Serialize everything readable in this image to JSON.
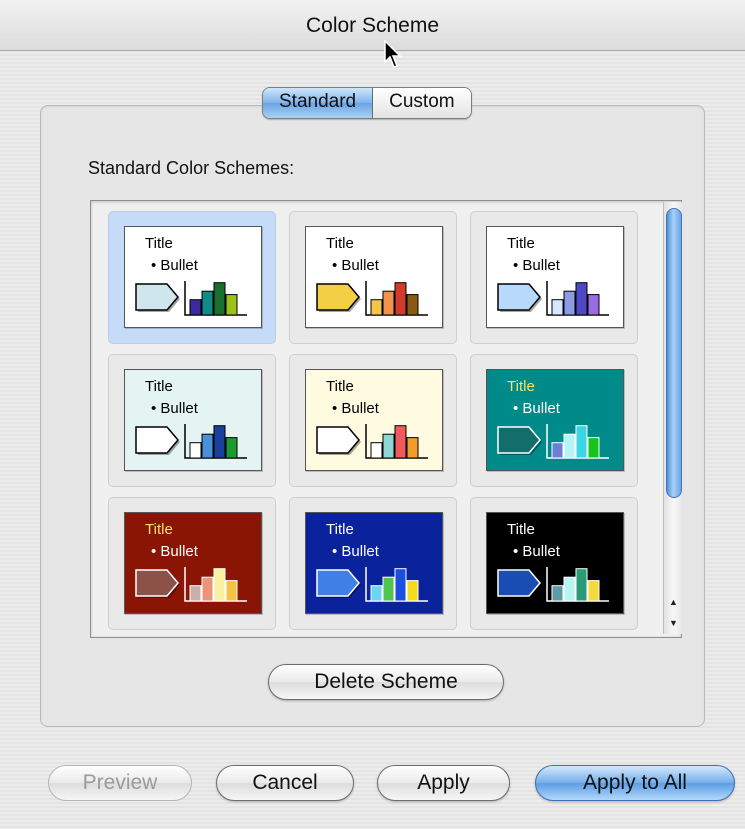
{
  "window": {
    "title": "Color Scheme"
  },
  "tabs": [
    {
      "label": "Standard",
      "active": true
    },
    {
      "label": "Custom",
      "active": false
    }
  ],
  "schemes_label": "Standard Color Schemes:",
  "schemes": [
    {
      "title": "Title",
      "bullet": "• Bullet",
      "bg": "#ffffff",
      "text": "#000000",
      "title_color": "#000000",
      "arrow": "#cfe6ec",
      "bars": [
        "#3b2a9e",
        "#118b86",
        "#1a6e2e",
        "#9bc11a"
      ],
      "selected": true
    },
    {
      "title": "Title",
      "bullet": "• Bullet",
      "bg": "#ffffff",
      "text": "#000000",
      "title_color": "#000000",
      "arrow": "#f2cf45",
      "bars": [
        "#f3c646",
        "#f2924e",
        "#d23b2c",
        "#8b5b12"
      ],
      "selected": false
    },
    {
      "title": "Title",
      "bullet": "• Bullet",
      "bg": "#ffffff",
      "text": "#000000",
      "title_color": "#000000",
      "arrow": "#b7d9fb",
      "bars": [
        "#d7e7ff",
        "#8c9be6",
        "#4e47c6",
        "#9a6ce3"
      ],
      "selected": false
    },
    {
      "title": "Title",
      "bullet": "• Bullet",
      "bg": "#e3f4f3",
      "text": "#000000",
      "title_color": "#000000",
      "arrow": "#ffffff",
      "bars": [
        "#ffffff",
        "#4a8fd9",
        "#1a3f9d",
        "#1c9a32"
      ],
      "selected": false
    },
    {
      "title": "Title",
      "bullet": "• Bullet",
      "bg": "#fffbe0",
      "text": "#000000",
      "title_color": "#000000",
      "arrow": "#ffffff",
      "bars": [
        "#ffffff",
        "#8fd7d2",
        "#f05a5a",
        "#f59b2a"
      ],
      "selected": false
    },
    {
      "title": "Title",
      "bullet": "• Bullet",
      "bg": "#008a8a",
      "text": "#ffffff",
      "title_color": "#f4e26a",
      "arrow": "#126d6b",
      "bars": [
        "#6e7fd6",
        "#b7f4f4",
        "#39d7e3",
        "#18c31c"
      ],
      "selected": false
    },
    {
      "title": "Title",
      "bullet": "• Bullet",
      "bg": "#8a1505",
      "text": "#ffffff",
      "title_color": "#f4e26a",
      "arrow": "#8c5247",
      "bars": [
        "#c8b1a8",
        "#e99579",
        "#f7f1a0",
        "#f5c343"
      ],
      "selected": false
    },
    {
      "title": "Title",
      "bullet": "• Bullet",
      "bg": "#0a239c",
      "text": "#ffffff",
      "title_color": "#ffffff",
      "arrow": "#3f7fe6",
      "bars": [
        "#6ad6f2",
        "#4fc44f",
        "#1b4fe0",
        "#f3dc1e"
      ],
      "selected": false
    },
    {
      "title": "Title",
      "bullet": "• Bullet",
      "bg": "#000000",
      "text": "#ffffff",
      "title_color": "#ffffff",
      "arrow": "#1a4db4",
      "bars": [
        "#5e9aa3",
        "#b6f5f0",
        "#2a9b77",
        "#f3db3a"
      ],
      "selected": false
    }
  ],
  "buttons": {
    "delete": "Delete Scheme",
    "preview": "Preview",
    "cancel": "Cancel",
    "apply": "Apply",
    "apply_all": "Apply to All"
  },
  "colors": {
    "accent": "#6aa4e2",
    "selection": "#c5dbf7"
  }
}
